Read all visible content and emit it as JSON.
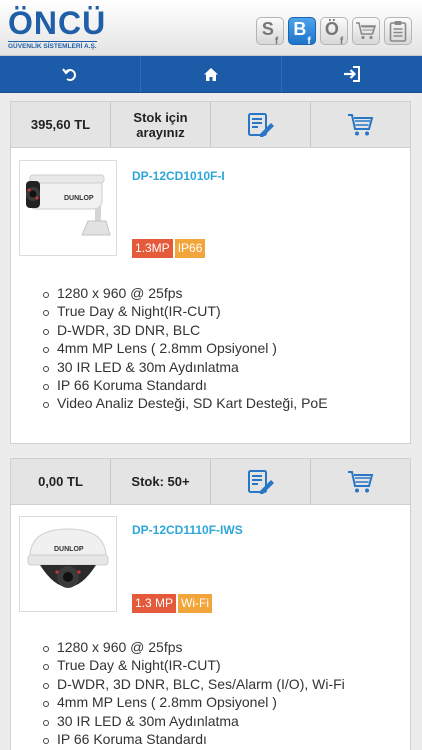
{
  "header": {
    "logo_main": "ÖNCÜ",
    "logo_sub": "GÜVENLİK SİSTEMLERİ A.Ş.",
    "buttons": [
      {
        "label": "S",
        "sub": "f",
        "icon": "sf-icon",
        "active": false
      },
      {
        "label": "B",
        "sub": "f",
        "icon": "bf-icon",
        "active": true
      },
      {
        "label": "Ö",
        "sub": "f",
        "icon": "of-icon",
        "active": false
      },
      {
        "icon": "cart-icon"
      },
      {
        "icon": "clipboard-icon"
      }
    ]
  },
  "nav": {
    "items": [
      {
        "icon": "back-icon"
      },
      {
        "icon": "home-icon"
      },
      {
        "icon": "login-icon"
      }
    ]
  },
  "products": [
    {
      "price": "395,60 TL",
      "stock_line1": "Stok için",
      "stock_line2": "arayınız",
      "name": "DP-12CD1010F-I",
      "badges": [
        "1.3MP",
        "IP66"
      ],
      "specs": [
        "1280 x 960 @ 25fps",
        "True Day & Night(IR-CUT)",
        "D-WDR, 3D DNR, BLC",
        "4mm MP Lens ( 2.8mm Opsiyonel )",
        "30 IR LED & 30m Aydınlatma",
        "IP 66 Koruma Standardı",
        "Video Analiz Desteği, SD Kart Desteği, PoE"
      ],
      "image_label": "DUNLOP"
    },
    {
      "price": "0,00 TL",
      "stock_line1": "Stok: 50+",
      "name": "DP-12CD1110F-IWS",
      "badges": [
        "1.3 MP",
        "Wi-Fi"
      ],
      "specs": [
        "1280 x 960 @ 25fps",
        "True Day & Night(IR-CUT)",
        "D-WDR, 3D DNR, BLC, Ses/Alarm (I/O), Wi-Fi",
        "4mm MP Lens ( 2.8mm Opsiyonel )",
        "30 IR LED & 30m Aydınlatma",
        "IP 66 Koruma Standardı"
      ],
      "image_label": "DUNLOP"
    }
  ],
  "colors": {
    "accent": "#1c5ba8",
    "product_name": "#2ea6d8",
    "badge_red": "#e55a3a",
    "badge_orange": "#f2a53a"
  }
}
